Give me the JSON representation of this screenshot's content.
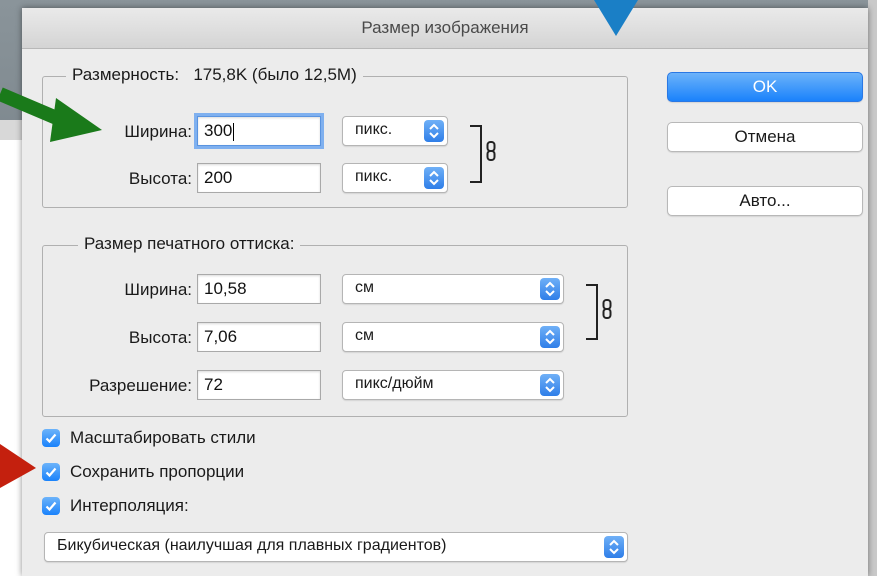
{
  "dialog": {
    "title": "Размер изображения",
    "pixel_group": {
      "legend_label": "Размерность:",
      "legend_value": "175,8K (было 12,5M)",
      "width_label": "Ширина:",
      "width_value": "300",
      "width_unit": "пикс.",
      "height_label": "Высота:",
      "height_value": "200",
      "height_unit": "пикс."
    },
    "print_group": {
      "legend": "Размер печатного оттиска:",
      "width_label": "Ширина:",
      "width_value": "10,58",
      "width_unit": "см",
      "height_label": "Высота:",
      "height_value": "7,06",
      "height_unit": "см",
      "resolution_label": "Разрешение:",
      "resolution_value": "72",
      "resolution_unit": "пикс/дюйм"
    },
    "options": {
      "scale_styles": {
        "label": "Масштабировать стили",
        "checked": true
      },
      "constrain": {
        "label": "Сохранить пропорции",
        "checked": true
      },
      "resample": {
        "label": "Интерполяция:",
        "checked": true
      }
    },
    "resample_method": "Бикубическая (наилучшая для плавных градиентов)",
    "buttons": {
      "ok": "OK",
      "cancel": "Отмена",
      "auto": "Авто..."
    }
  },
  "annotations": {
    "green_arrow_color": "#1a7a1a",
    "red_arrow_color": "#c4200e",
    "blue_arrow_color": "#1a7fc6"
  },
  "icons": [
    "chain-link-icon",
    "stepper-icon",
    "checkmark-icon"
  ]
}
